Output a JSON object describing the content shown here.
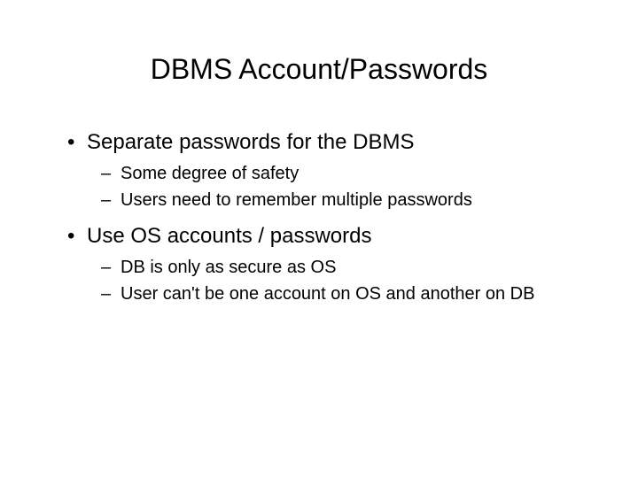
{
  "slide": {
    "title": "DBMS Account/Passwords",
    "bullets": [
      {
        "text": "Separate passwords for the DBMS",
        "children": [
          "Some degree of safety",
          "Users need to remember multiple passwords"
        ]
      },
      {
        "text": "Use OS accounts / passwords",
        "children": [
          "DB is only as secure as OS",
          "User can't be one account on OS and another on DB"
        ]
      }
    ]
  }
}
